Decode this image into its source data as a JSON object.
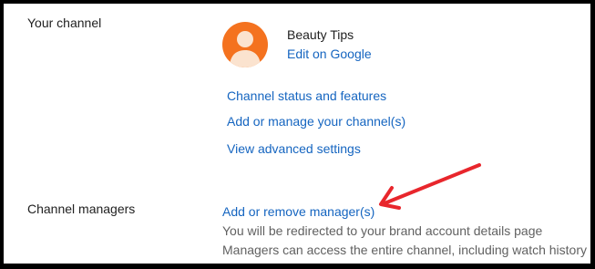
{
  "channel": {
    "label": "Your channel",
    "name": "Beauty Tips",
    "edit_link": "Edit on Google",
    "links": [
      "Channel status and features",
      "Add or manage your channel(s)",
      "View advanced settings"
    ],
    "avatar_icon": "person-avatar-icon",
    "avatar_color": "#f4721f"
  },
  "managers": {
    "label": "Channel managers",
    "link": "Add or remove manager(s)",
    "notes": [
      "You will be redirected to your brand account details page",
      "Managers can access the entire channel, including watch history"
    ]
  },
  "annotation": {
    "icon": "red-arrow-icon",
    "color": "#e8262c"
  }
}
